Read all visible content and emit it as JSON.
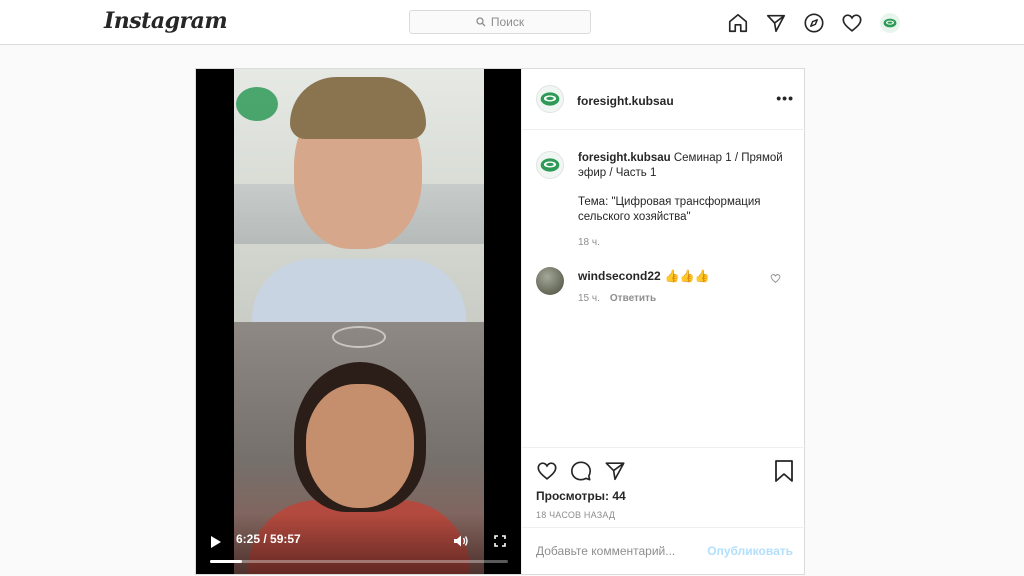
{
  "header": {
    "logo": "Instagram",
    "search_placeholder": "Поиск"
  },
  "post": {
    "video": {
      "time_display": "6:25 / 59:57",
      "progress_fraction": 0.107
    },
    "author": {
      "username": "foresight.kubsau"
    },
    "caption": {
      "username": "foresight.kubsau",
      "line1": "Семинар 1 / Прямой эфир / Часть 1",
      "line2": "Тема: \"Цифровая трансформация сельского хозяйства\"",
      "time": "18 ч."
    },
    "comments": [
      {
        "username": "windsecond22",
        "text": "👍👍👍",
        "time": "15 ч.",
        "reply_label": "Ответить"
      }
    ],
    "views_label": "Просмотры: 44",
    "posted_ago": "18 ЧАСОВ НАЗАД",
    "add_comment_placeholder": "Добавьте комментарий...",
    "publish_label": "Опубликовать"
  },
  "colors": {
    "accent_blue_disabled": "#b2dffc",
    "brand_green": "#2f9a58"
  }
}
